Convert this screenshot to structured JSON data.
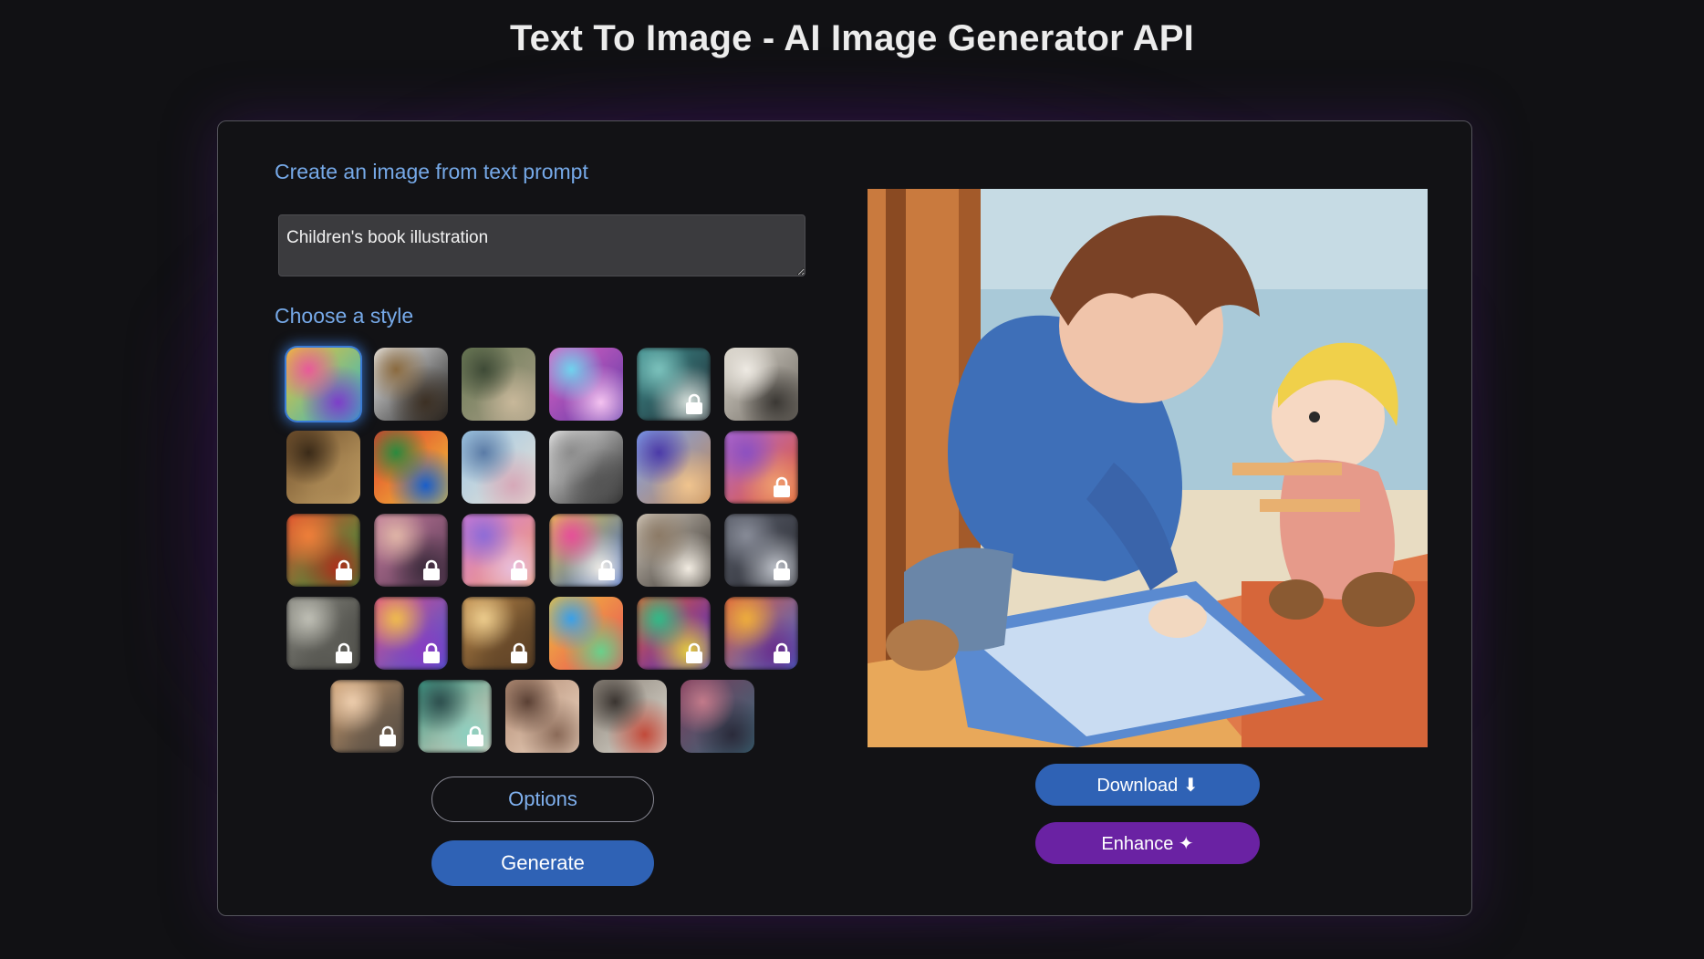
{
  "page": {
    "title": "Text To Image - AI Image Generator API"
  },
  "generator": {
    "heading": "Create an image from text prompt",
    "prompt_value": "Children's book illustration",
    "style_heading": "Choose a style"
  },
  "styles": [
    {
      "locked": false,
      "selected": true,
      "colors": [
        "#f0c431",
        "#29b6c9",
        "#e85a9a",
        "#7d3ec9"
      ]
    },
    {
      "locked": false,
      "selected": false,
      "colors": [
        "#f3f3f3",
        "#1b1b1b",
        "#8a6a3f",
        "#3c3024"
      ]
    },
    {
      "locked": false,
      "selected": false,
      "colors": [
        "#6b7a55",
        "#a79d86",
        "#3e4a36",
        "#c8b89a"
      ]
    },
    {
      "locked": false,
      "selected": false,
      "colors": [
        "#e062c4",
        "#5a3aa6",
        "#6fd3ee",
        "#f4c2f0"
      ]
    },
    {
      "locked": true,
      "selected": false,
      "colors": [
        "#3f8f8f",
        "#1e2b33",
        "#7fc6c0",
        "#d9e3de"
      ]
    },
    {
      "locked": false,
      "selected": false,
      "colors": [
        "#d8d3c9",
        "#6c6760",
        "#eeeae3",
        "#3b3834"
      ]
    },
    {
      "locked": false,
      "selected": false,
      "colors": [
        "#6f4e2b",
        "#c9a76a",
        "#3a2a18",
        "#a88552"
      ]
    },
    {
      "locked": false,
      "selected": false,
      "colors": [
        "#e23a2c",
        "#f0c93a",
        "#2b8a3e",
        "#1a5ec9"
      ]
    },
    {
      "locked": false,
      "selected": false,
      "colors": [
        "#9ec8e6",
        "#e8e0d4",
        "#5a7ba6",
        "#d6a8b8"
      ]
    },
    {
      "locked": false,
      "selected": false,
      "colors": [
        "#f2f2f2",
        "#222222",
        "#8c8c8c",
        "#555555"
      ]
    },
    {
      "locked": false,
      "selected": false,
      "colors": [
        "#7ea2f0",
        "#c28a52",
        "#4b3aa8",
        "#f0c48e"
      ]
    },
    {
      "locked": true,
      "selected": false,
      "colors": [
        "#b06ad6",
        "#e35a2a",
        "#8a4fc2",
        "#f0a070"
      ]
    },
    {
      "locked": true,
      "selected": false,
      "colors": [
        "#e34a2c",
        "#1e9a3e",
        "#f2803a",
        "#b22a1a"
      ]
    },
    {
      "locked": true,
      "selected": false,
      "colors": [
        "#c27a9c",
        "#5a3a55",
        "#e2b8a8",
        "#3a2a3a"
      ]
    },
    {
      "locked": true,
      "selected": false,
      "colors": [
        "#d47ad8",
        "#f0a070",
        "#8a6ad8",
        "#e8c0e0"
      ]
    },
    {
      "locked": true,
      "selected": false,
      "colors": [
        "#f2d04a",
        "#2a5ac9",
        "#e84a9a",
        "#f4f0e8"
      ]
    },
    {
      "locked": false,
      "selected": false,
      "colors": [
        "#d8cfc2",
        "#2a2622",
        "#8c7a66",
        "#f2ece2"
      ]
    },
    {
      "locked": true,
      "selected": false,
      "colors": [
        "#5a5e6a",
        "#2a2c33",
        "#8a8e9a",
        "#c0c4cc"
      ]
    },
    {
      "locked": true,
      "selected": false,
      "colors": [
        "#8a8a82",
        "#3a3a36",
        "#c2c2b8",
        "#5e5e58"
      ]
    },
    {
      "locked": true,
      "selected": false,
      "colors": [
        "#e24a8a",
        "#3a5ad6",
        "#f2c04a",
        "#8a3ac2"
      ]
    },
    {
      "locked": true,
      "selected": false,
      "colors": [
        "#c08a4a",
        "#3a2a1a",
        "#f0d090",
        "#6a4a2a"
      ]
    },
    {
      "locked": false,
      "selected": false,
      "colors": [
        "#f2c23a",
        "#e84a5a",
        "#3aa0e8",
        "#6ad08a"
      ]
    },
    {
      "locked": true,
      "selected": false,
      "colors": [
        "#f05a2a",
        "#3a2ad6",
        "#2ac08a",
        "#e8d03a"
      ]
    },
    {
      "locked": true,
      "selected": false,
      "colors": [
        "#e25a3a",
        "#3a6ad6",
        "#f0b03a",
        "#6a2a8a"
      ]
    },
    {
      "locked": true,
      "selected": false,
      "colors": [
        "#d0a070",
        "#3a3a3a",
        "#f0d0b0",
        "#6a5a4a"
      ]
    },
    {
      "locked": true,
      "selected": false,
      "colors": [
        "#3aa08a",
        "#e8d0c0",
        "#2a4a4a",
        "#8ad0c0"
      ]
    },
    {
      "locked": false,
      "selected": false,
      "colors": [
        "#b08a72",
        "#f0d8c4",
        "#5a4034",
        "#8a6a58"
      ]
    },
    {
      "locked": false,
      "selected": false,
      "colors": [
        "#8a8278",
        "#e0dcd2",
        "#3a3430",
        "#c24a3a"
      ]
    },
    {
      "locked": false,
      "selected": false,
      "colors": [
        "#7a3a5a",
        "#3a6a7a",
        "#c27a8a",
        "#2a2a3a"
      ]
    }
  ],
  "buttons": {
    "options": "Options",
    "generate": "Generate",
    "download": "Download ⬇",
    "enhance": "Enhance ✦"
  },
  "icons": {
    "lock": "lock-icon"
  },
  "colors": {
    "accent_blue": "#2f62b5",
    "accent_purple": "#6a22a3",
    "heading_blue": "#76a9e8",
    "background": "#111114"
  }
}
